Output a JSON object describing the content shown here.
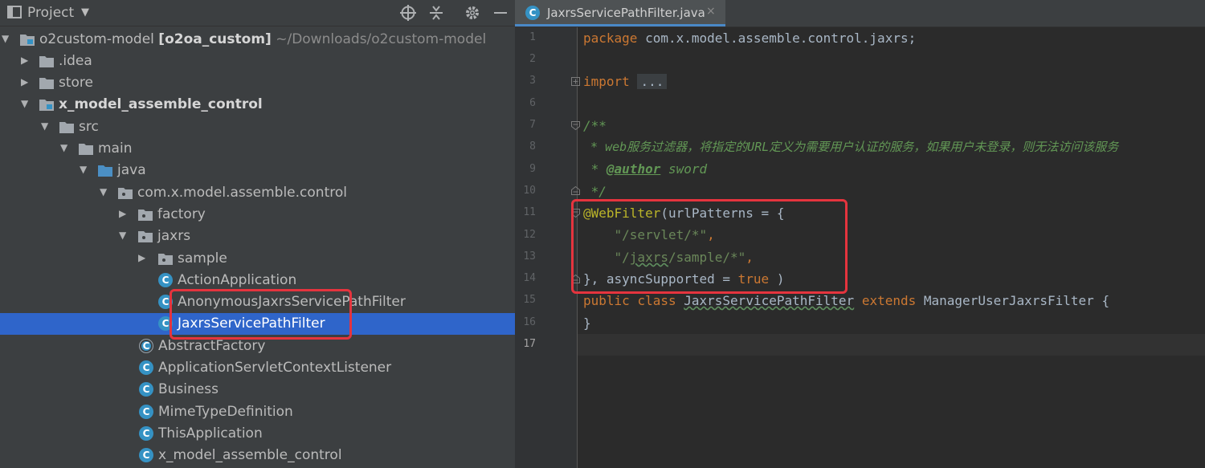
{
  "project_panel": {
    "title": "Project",
    "root": {
      "name": "o2custom-model",
      "module": "[o2oa_custom]",
      "path": "~/Downloads/o2custom-model"
    },
    "tree": [
      {
        "label": ".idea",
        "icon": "folder-icon"
      },
      {
        "label": "store",
        "icon": "folder-icon"
      },
      {
        "label": "x_model_assemble_control",
        "icon": "module-folder-icon"
      },
      {
        "label": "src",
        "icon": "folder-icon"
      },
      {
        "label": "main",
        "icon": "folder-icon"
      },
      {
        "label": "java",
        "icon": "source-folder-icon"
      },
      {
        "label": "com.x.model.assemble.control",
        "icon": "package-icon"
      },
      {
        "label": "factory",
        "icon": "package-icon"
      },
      {
        "label": "jaxrs",
        "icon": "package-icon"
      },
      {
        "label": "sample",
        "icon": "package-icon"
      },
      {
        "label": "ActionApplication",
        "icon": "class-icon"
      },
      {
        "label": "AnonymousJaxrsServicePathFilter",
        "icon": "class-icon"
      },
      {
        "label": "JaxrsServicePathFilter",
        "icon": "class-icon",
        "selected": true
      },
      {
        "label": "AbstractFactory",
        "icon": "abstract-class-icon"
      },
      {
        "label": "ApplicationServletContextListener",
        "icon": "class-icon"
      },
      {
        "label": "Business",
        "icon": "class-icon"
      },
      {
        "label": "MimeTypeDefinition",
        "icon": "class-icon"
      },
      {
        "label": "ThisApplication",
        "icon": "class-icon"
      },
      {
        "label": "x_model_assemble_control",
        "icon": "class-icon"
      }
    ]
  },
  "editor": {
    "tab": {
      "label": "JaxrsServicePathFilter.java",
      "close": "×"
    },
    "line_numbers": [
      "1",
      "2",
      "3",
      "6",
      "7",
      "8",
      "9",
      "10",
      "11",
      "12",
      "13",
      "14",
      "15",
      "16",
      "17"
    ],
    "code": {
      "l1_kw": "package",
      "l1_rest": " com.x.model.assemble.control.jaxrs;",
      "l3_kw": "import",
      "l3_fold": "...",
      "l7": "/**",
      "l8": " * web服务过滤器，将指定的URL定义为需要用户认证的服务，如果用户未登录，则无法访问该服务",
      "l9_star": " * ",
      "l9_tag": "@author",
      "l9_rest": " sword",
      "l10": " */",
      "l11_ann": "@WebFilter",
      "l11_rest": "(urlPatterns = {",
      "l12_indent": "    ",
      "l12_str": "\"/servlet/*\"",
      "l12_comma": ",",
      "l13_indent": "    ",
      "l13_str_a": "\"/",
      "l13_str_b": "jaxrs",
      "l13_str_c": "/sample/*\"",
      "l13_comma": ",",
      "l14_a": "}, asyncSupported = ",
      "l14_kw": "true",
      "l14_b": " )",
      "l15_kw1": "public",
      "l15_kw2": "class",
      "l15_name": "JaxrsServicePathFilter",
      "l15_kw3": "extends",
      "l15_rest": " ManagerUserJaxrsFilter {",
      "l16": "}"
    }
  },
  "colors": {
    "selection": "#2f65ca",
    "highlight_box": "#e5343e",
    "class_icon": "#3592c4"
  }
}
